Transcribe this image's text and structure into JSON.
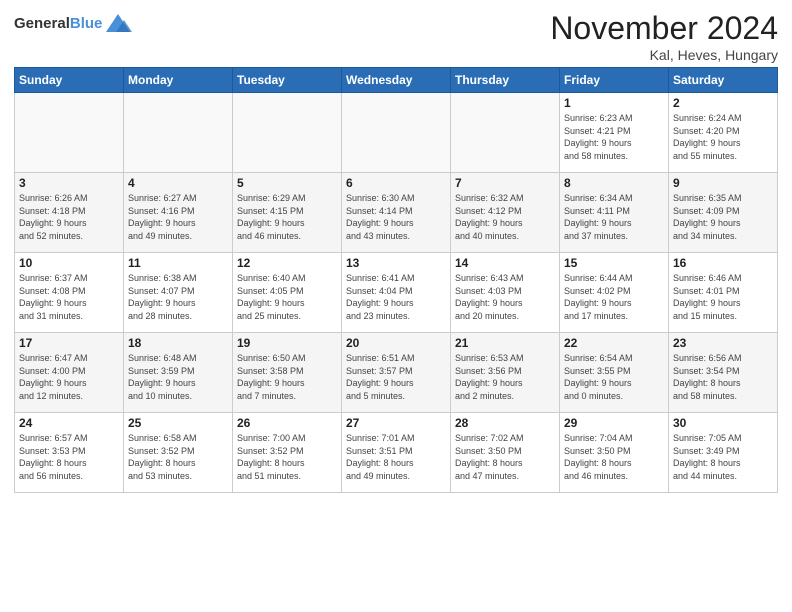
{
  "header": {
    "logo_general": "General",
    "logo_blue": "Blue",
    "month_title": "November 2024",
    "location": "Kal, Heves, Hungary"
  },
  "weekdays": [
    "Sunday",
    "Monday",
    "Tuesday",
    "Wednesday",
    "Thursday",
    "Friday",
    "Saturday"
  ],
  "weeks": [
    [
      {
        "day": "",
        "detail": ""
      },
      {
        "day": "",
        "detail": ""
      },
      {
        "day": "",
        "detail": ""
      },
      {
        "day": "",
        "detail": ""
      },
      {
        "day": "",
        "detail": ""
      },
      {
        "day": "1",
        "detail": "Sunrise: 6:23 AM\nSunset: 4:21 PM\nDaylight: 9 hours\nand 58 minutes."
      },
      {
        "day": "2",
        "detail": "Sunrise: 6:24 AM\nSunset: 4:20 PM\nDaylight: 9 hours\nand 55 minutes."
      }
    ],
    [
      {
        "day": "3",
        "detail": "Sunrise: 6:26 AM\nSunset: 4:18 PM\nDaylight: 9 hours\nand 52 minutes."
      },
      {
        "day": "4",
        "detail": "Sunrise: 6:27 AM\nSunset: 4:16 PM\nDaylight: 9 hours\nand 49 minutes."
      },
      {
        "day": "5",
        "detail": "Sunrise: 6:29 AM\nSunset: 4:15 PM\nDaylight: 9 hours\nand 46 minutes."
      },
      {
        "day": "6",
        "detail": "Sunrise: 6:30 AM\nSunset: 4:14 PM\nDaylight: 9 hours\nand 43 minutes."
      },
      {
        "day": "7",
        "detail": "Sunrise: 6:32 AM\nSunset: 4:12 PM\nDaylight: 9 hours\nand 40 minutes."
      },
      {
        "day": "8",
        "detail": "Sunrise: 6:34 AM\nSunset: 4:11 PM\nDaylight: 9 hours\nand 37 minutes."
      },
      {
        "day": "9",
        "detail": "Sunrise: 6:35 AM\nSunset: 4:09 PM\nDaylight: 9 hours\nand 34 minutes."
      }
    ],
    [
      {
        "day": "10",
        "detail": "Sunrise: 6:37 AM\nSunset: 4:08 PM\nDaylight: 9 hours\nand 31 minutes."
      },
      {
        "day": "11",
        "detail": "Sunrise: 6:38 AM\nSunset: 4:07 PM\nDaylight: 9 hours\nand 28 minutes."
      },
      {
        "day": "12",
        "detail": "Sunrise: 6:40 AM\nSunset: 4:05 PM\nDaylight: 9 hours\nand 25 minutes."
      },
      {
        "day": "13",
        "detail": "Sunrise: 6:41 AM\nSunset: 4:04 PM\nDaylight: 9 hours\nand 23 minutes."
      },
      {
        "day": "14",
        "detail": "Sunrise: 6:43 AM\nSunset: 4:03 PM\nDaylight: 9 hours\nand 20 minutes."
      },
      {
        "day": "15",
        "detail": "Sunrise: 6:44 AM\nSunset: 4:02 PM\nDaylight: 9 hours\nand 17 minutes."
      },
      {
        "day": "16",
        "detail": "Sunrise: 6:46 AM\nSunset: 4:01 PM\nDaylight: 9 hours\nand 15 minutes."
      }
    ],
    [
      {
        "day": "17",
        "detail": "Sunrise: 6:47 AM\nSunset: 4:00 PM\nDaylight: 9 hours\nand 12 minutes."
      },
      {
        "day": "18",
        "detail": "Sunrise: 6:48 AM\nSunset: 3:59 PM\nDaylight: 9 hours\nand 10 minutes."
      },
      {
        "day": "19",
        "detail": "Sunrise: 6:50 AM\nSunset: 3:58 PM\nDaylight: 9 hours\nand 7 minutes."
      },
      {
        "day": "20",
        "detail": "Sunrise: 6:51 AM\nSunset: 3:57 PM\nDaylight: 9 hours\nand 5 minutes."
      },
      {
        "day": "21",
        "detail": "Sunrise: 6:53 AM\nSunset: 3:56 PM\nDaylight: 9 hours\nand 2 minutes."
      },
      {
        "day": "22",
        "detail": "Sunrise: 6:54 AM\nSunset: 3:55 PM\nDaylight: 9 hours\nand 0 minutes."
      },
      {
        "day": "23",
        "detail": "Sunrise: 6:56 AM\nSunset: 3:54 PM\nDaylight: 8 hours\nand 58 minutes."
      }
    ],
    [
      {
        "day": "24",
        "detail": "Sunrise: 6:57 AM\nSunset: 3:53 PM\nDaylight: 8 hours\nand 56 minutes."
      },
      {
        "day": "25",
        "detail": "Sunrise: 6:58 AM\nSunset: 3:52 PM\nDaylight: 8 hours\nand 53 minutes."
      },
      {
        "day": "26",
        "detail": "Sunrise: 7:00 AM\nSunset: 3:52 PM\nDaylight: 8 hours\nand 51 minutes."
      },
      {
        "day": "27",
        "detail": "Sunrise: 7:01 AM\nSunset: 3:51 PM\nDaylight: 8 hours\nand 49 minutes."
      },
      {
        "day": "28",
        "detail": "Sunrise: 7:02 AM\nSunset: 3:50 PM\nDaylight: 8 hours\nand 47 minutes."
      },
      {
        "day": "29",
        "detail": "Sunrise: 7:04 AM\nSunset: 3:50 PM\nDaylight: 8 hours\nand 46 minutes."
      },
      {
        "day": "30",
        "detail": "Sunrise: 7:05 AM\nSunset: 3:49 PM\nDaylight: 8 hours\nand 44 minutes."
      }
    ]
  ]
}
